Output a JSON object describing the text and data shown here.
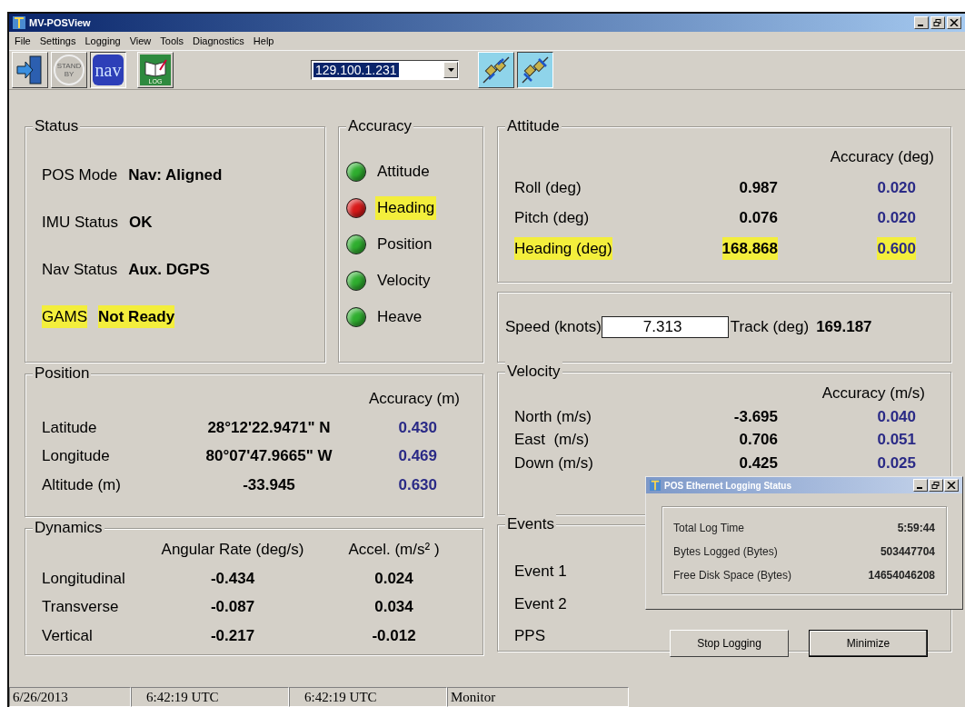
{
  "window": {
    "title": "MV-POSView"
  },
  "menu": [
    "File",
    "Settings",
    "Logging",
    "View",
    "Tools",
    "Diagnostics",
    "Help"
  ],
  "toolbar": {
    "buttons": [
      {
        "kind": "exit",
        "disabled": false,
        "pressed": false
      },
      {
        "kind": "standby",
        "label": "STAND BY",
        "disabled": true,
        "pressed": false
      },
      {
        "kind": "nav",
        "label": "nav",
        "disabled": false,
        "pressed": true
      },
      {
        "kind": "log",
        "label": "LOG",
        "disabled": false,
        "pressed": false
      }
    ],
    "address": "129.100.1.231",
    "links": [
      {
        "kind": "connect",
        "pressed": false
      },
      {
        "kind": "disconnect",
        "pressed": true
      }
    ]
  },
  "status": {
    "title": "Status",
    "rows": [
      {
        "label": "POS Mode",
        "value": "Nav: Aligned",
        "highlighted": false
      },
      {
        "label": "IMU Status",
        "value": "OK",
        "highlighted": false
      },
      {
        "label": "Nav Status",
        "value": "Aux. DGPS",
        "highlighted": false
      },
      {
        "label": "GAMS",
        "value": "Not Ready",
        "highlighted": true
      }
    ]
  },
  "accuracy": {
    "title": "Accuracy",
    "items": [
      {
        "label": "Attitude",
        "color": "#2fae2f",
        "highlighted": false
      },
      {
        "label": "Heading",
        "color": "#d81a1a",
        "highlighted": true
      },
      {
        "label": "Position",
        "color": "#2fae2f",
        "highlighted": false
      },
      {
        "label": "Velocity",
        "color": "#2fae2f",
        "highlighted": false
      },
      {
        "label": "Heave",
        "color": "#2fae2f",
        "highlighted": false
      }
    ]
  },
  "attitude": {
    "title": "Attitude",
    "header": "Accuracy (deg)",
    "rows": [
      {
        "label": "Roll (deg)",
        "value": "0.987",
        "accuracy": "0.020",
        "highlighted": false
      },
      {
        "label": "Pitch (deg)",
        "value": "0.076",
        "accuracy": "0.020",
        "highlighted": false
      },
      {
        "label": "Heading (deg)",
        "value": "168.868",
        "accuracy": "0.600",
        "highlighted": true
      }
    ]
  },
  "speed": {
    "label": "Speed (knots)",
    "value": "7.313",
    "track_label": "Track (deg)",
    "track_value": "169.187"
  },
  "position": {
    "title": "Position",
    "header": "Accuracy (m)",
    "rows": [
      {
        "label": "Latitude",
        "value": "28°12'22.9471\" N",
        "accuracy": "0.430"
      },
      {
        "label": "Longitude",
        "value": "80°07'47.9665\" W",
        "accuracy": "0.469"
      },
      {
        "label": "Altitude (m)",
        "value": "-33.945",
        "accuracy": "0.630"
      }
    ]
  },
  "velocity": {
    "title": "Velocity",
    "header": "Accuracy (m/s)",
    "rows": [
      {
        "label": "North (m/s)",
        "value": "-3.695",
        "accuracy": "0.040"
      },
      {
        "label": "East  (m/s)",
        "value": "0.706",
        "accuracy": "0.051"
      },
      {
        "label": "Down (m/s)",
        "value": "0.425",
        "accuracy": "0.025"
      }
    ]
  },
  "dynamics": {
    "title": "Dynamics",
    "headers": [
      "Angular Rate (deg/s)",
      "Accel. (m/s² )"
    ],
    "rows": [
      {
        "label": "Longitudinal",
        "rate": "-0.434",
        "accel": "0.024"
      },
      {
        "label": "Transverse",
        "rate": "-0.087",
        "accel": "0.034"
      },
      {
        "label": "Vertical",
        "rate": "-0.217",
        "accel": "-0.012"
      }
    ]
  },
  "events": {
    "title": "Events",
    "rows": [
      "Event 1",
      "Event 2",
      "PPS"
    ]
  },
  "dialog": {
    "title": "POS Ethernet Logging Status",
    "rows": [
      {
        "label": "Total Log Time",
        "value": "5:59:44"
      },
      {
        "label": "Bytes Logged (Bytes)",
        "value": "503447704"
      },
      {
        "label": "Free Disk Space (Bytes)",
        "value": "14654046208"
      }
    ],
    "buttons": [
      {
        "label": "Stop Logging",
        "default": false
      },
      {
        "label": "Minimize",
        "default": true
      }
    ]
  },
  "status_bar": [
    "6/26/2013",
    "6:42:19 UTC",
    "6:42:19 UTC",
    "Monitor"
  ]
}
